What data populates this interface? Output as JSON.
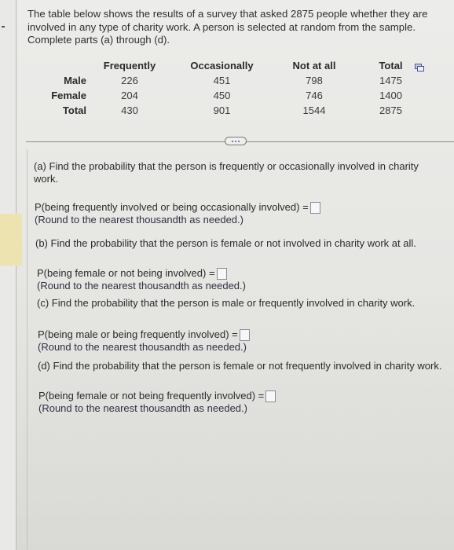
{
  "intro": {
    "line1": "The table below shows the results of a survey that asked 2875 people whether they are",
    "line2": "involved in any type of charity work. A person is selected at random from the sample.",
    "line3": "Complete parts (a) through (d)."
  },
  "table": {
    "headers": [
      "",
      "Frequently",
      "Occasionally",
      "Not at all",
      "Total"
    ],
    "rows": [
      {
        "label": "Male",
        "values": [
          "226",
          "451",
          "798",
          "1475"
        ]
      },
      {
        "label": "Female",
        "values": [
          "204",
          "450",
          "746",
          "1400"
        ]
      },
      {
        "label": "Total",
        "values": [
          "430",
          "901",
          "1544",
          "2875"
        ]
      }
    ],
    "copy_icon": "copy-table-icon"
  },
  "more_button_icon": "ellipsis-icon",
  "questions": {
    "a": {
      "prompt_line1": "(a) Find the probability that the person is frequently or occasionally involved in charity",
      "prompt_line2": "work.",
      "answer_label": "P(being frequently involved or being occasionally involved) =",
      "answer_value": "",
      "note": "(Round to the nearest thousandth as needed.)"
    },
    "b": {
      "prompt": "(b) Find the probability that the person is female or not involved in charity work at all.",
      "answer_label": "P(being female or not being involved) =",
      "answer_value": "",
      "note": "(Round to the nearest thousandth as needed.)"
    },
    "c": {
      "prompt": "(c) Find the probability that the person is male or frequently involved in charity work.",
      "answer_label": "P(being male or being frequently involved) =",
      "answer_value": "",
      "note": "(Round to the nearest thousandth as needed.)"
    },
    "d": {
      "prompt": "(d) Find the probability that the person is female or not frequently involved in charity work.",
      "answer_label": "P(being female or not being frequently involved) =",
      "answer_value": "",
      "note": "(Round to the nearest thousandth as needed.)"
    }
  }
}
